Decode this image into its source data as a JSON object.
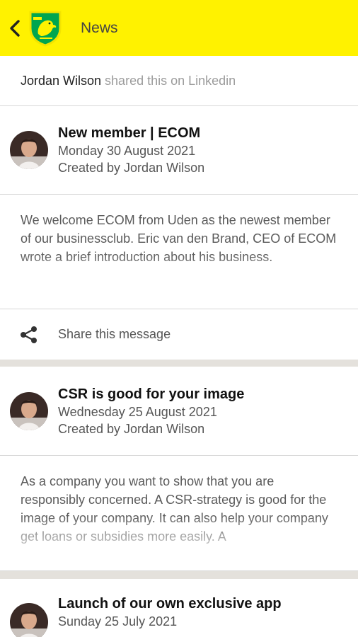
{
  "appbar": {
    "title": "News",
    "back_icon": "chevron-left-icon",
    "logo_icon": "club-crest-icon",
    "color": "#fff200"
  },
  "shared": {
    "name": "Jordan Wilson",
    "text": "shared this on Linkedin"
  },
  "posts": [
    {
      "title": "New member | ECOM",
      "date": "Monday 30 August 2021",
      "author": "Created by Jordan Wilson",
      "body": "We welcome ECOM from Uden as the newest member of our businessclub. Eric van den Brand, CEO of ECOM wrote a brief introduction about his business.",
      "share_label": "Share this message"
    },
    {
      "title": "CSR is good for your image",
      "date": "Wednesday 25 August 2021",
      "author": "Created by Jordan Wilson",
      "body": "As a company you want to show that you are responsibly concerned. A CSR-strategy is good for the image of your company. It can also help your company get loans or subsidies more easily. A"
    },
    {
      "title": "Launch of our own exclusive app",
      "date": "Sunday 25 July 2021"
    }
  ]
}
